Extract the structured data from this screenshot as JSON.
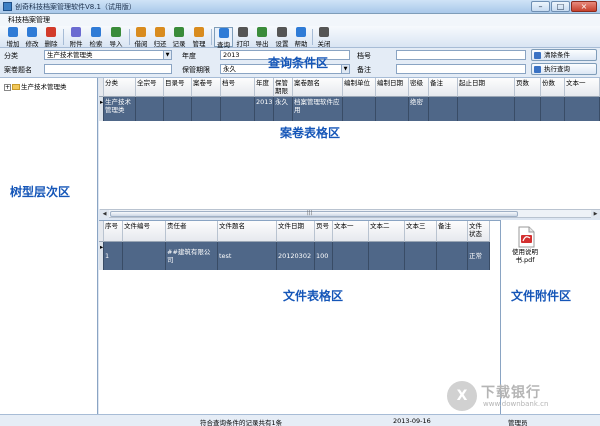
{
  "window": {
    "title": "创奇科技档案管理软件V8.1（试用版）",
    "min": "–",
    "max": "□",
    "close": "×"
  },
  "menu": {
    "label": "科技档案管理"
  },
  "toolbar": {
    "items": [
      {
        "label": "增加",
        "icon": "add-icon",
        "color": "#2f7bd6"
      },
      {
        "label": "修改",
        "icon": "edit-icon",
        "color": "#2f7bd6"
      },
      {
        "label": "删除",
        "icon": "delete-icon",
        "color": "#d23b2b"
      },
      {
        "label": "附件",
        "icon": "attachment-icon",
        "color": "#6b6bd1"
      },
      {
        "label": "检索",
        "icon": "search-icon",
        "color": "#2f7bd6"
      },
      {
        "label": "导入",
        "icon": "import-icon",
        "color": "#3a8c3a"
      },
      {
        "label": "借阅",
        "icon": "borrow-icon",
        "color": "#d98c1f"
      },
      {
        "label": "归还",
        "icon": "return-icon",
        "color": "#d98c1f"
      },
      {
        "label": "记录",
        "icon": "record-icon",
        "color": "#3a8c3a"
      },
      {
        "label": "管理",
        "icon": "manage-icon",
        "color": "#d98c1f"
      },
      {
        "label": "查询",
        "icon": "query-icon",
        "color": "#2f7bd6"
      },
      {
        "label": "打印",
        "icon": "print-icon",
        "color": "#555555"
      },
      {
        "label": "导出",
        "icon": "export-icon",
        "color": "#3a8c3a"
      },
      {
        "label": "设置",
        "icon": "settings-icon",
        "color": "#555555"
      },
      {
        "label": "帮助",
        "icon": "help-icon",
        "color": "#2f7bd6"
      },
      {
        "label": "关闭",
        "icon": "close-app-icon",
        "color": "#555555"
      }
    ]
  },
  "query": {
    "category_label": "分类",
    "category_value": "生产技术管理类",
    "year_label": "年度",
    "year_value": "2013",
    "file_no_label": "档号",
    "file_no_value": "",
    "title_label": "案卷题名",
    "title_value": "",
    "retention_label": "保管期限",
    "retention_value": "永久",
    "remark_label": "备注",
    "remark_value": "",
    "clear_button": "清除条件",
    "execute_button": "执行查询"
  },
  "tree": {
    "root": "生产技术管理类",
    "expander": "+"
  },
  "overlays": {
    "query_area": "查询条件区",
    "volume_grid": "案卷表格区",
    "tree_area": "树型层次区",
    "file_grid": "文件表格区",
    "attachment_area": "文件附件区"
  },
  "volume_grid": {
    "columns": [
      "分类",
      "全宗号",
      "目录号",
      "案卷号",
      "档号",
      "年度",
      "保管期限",
      "案卷题名",
      "编制单位",
      "编制日期",
      "密级",
      "备注",
      "起止日期",
      "页数",
      "份数",
      "文本一"
    ],
    "rows": [
      [
        "生产技术管理类",
        "",
        "",
        "",
        "",
        "2013",
        "永久",
        "档案管理软件应用",
        "",
        "",
        "绝密",
        "",
        "",
        "",
        "",
        ""
      ]
    ]
  },
  "file_grid": {
    "columns": [
      "序号",
      "文件编号",
      "责任者",
      "文件题名",
      "文件日期",
      "页号",
      "文本一",
      "文本二",
      "文本三",
      "备注",
      "文件状态"
    ],
    "rows": [
      [
        "1",
        "",
        "##建筑有限公司",
        "test",
        "20120302",
        "100",
        "",
        "",
        "",
        "",
        "正常"
      ]
    ]
  },
  "scrollbar": {
    "left": "◀",
    "right": "▶",
    "grip": "|||"
  },
  "attachment": {
    "file_name": "使用说明书.pdf"
  },
  "status": {
    "record_count": "符合查询条件的记录共有1条",
    "date": "2013-09-16",
    "user": "管理员"
  },
  "watermark": {
    "logo_text": "X",
    "line1": "下载银行",
    "line2": "www.downbank.cn"
  }
}
